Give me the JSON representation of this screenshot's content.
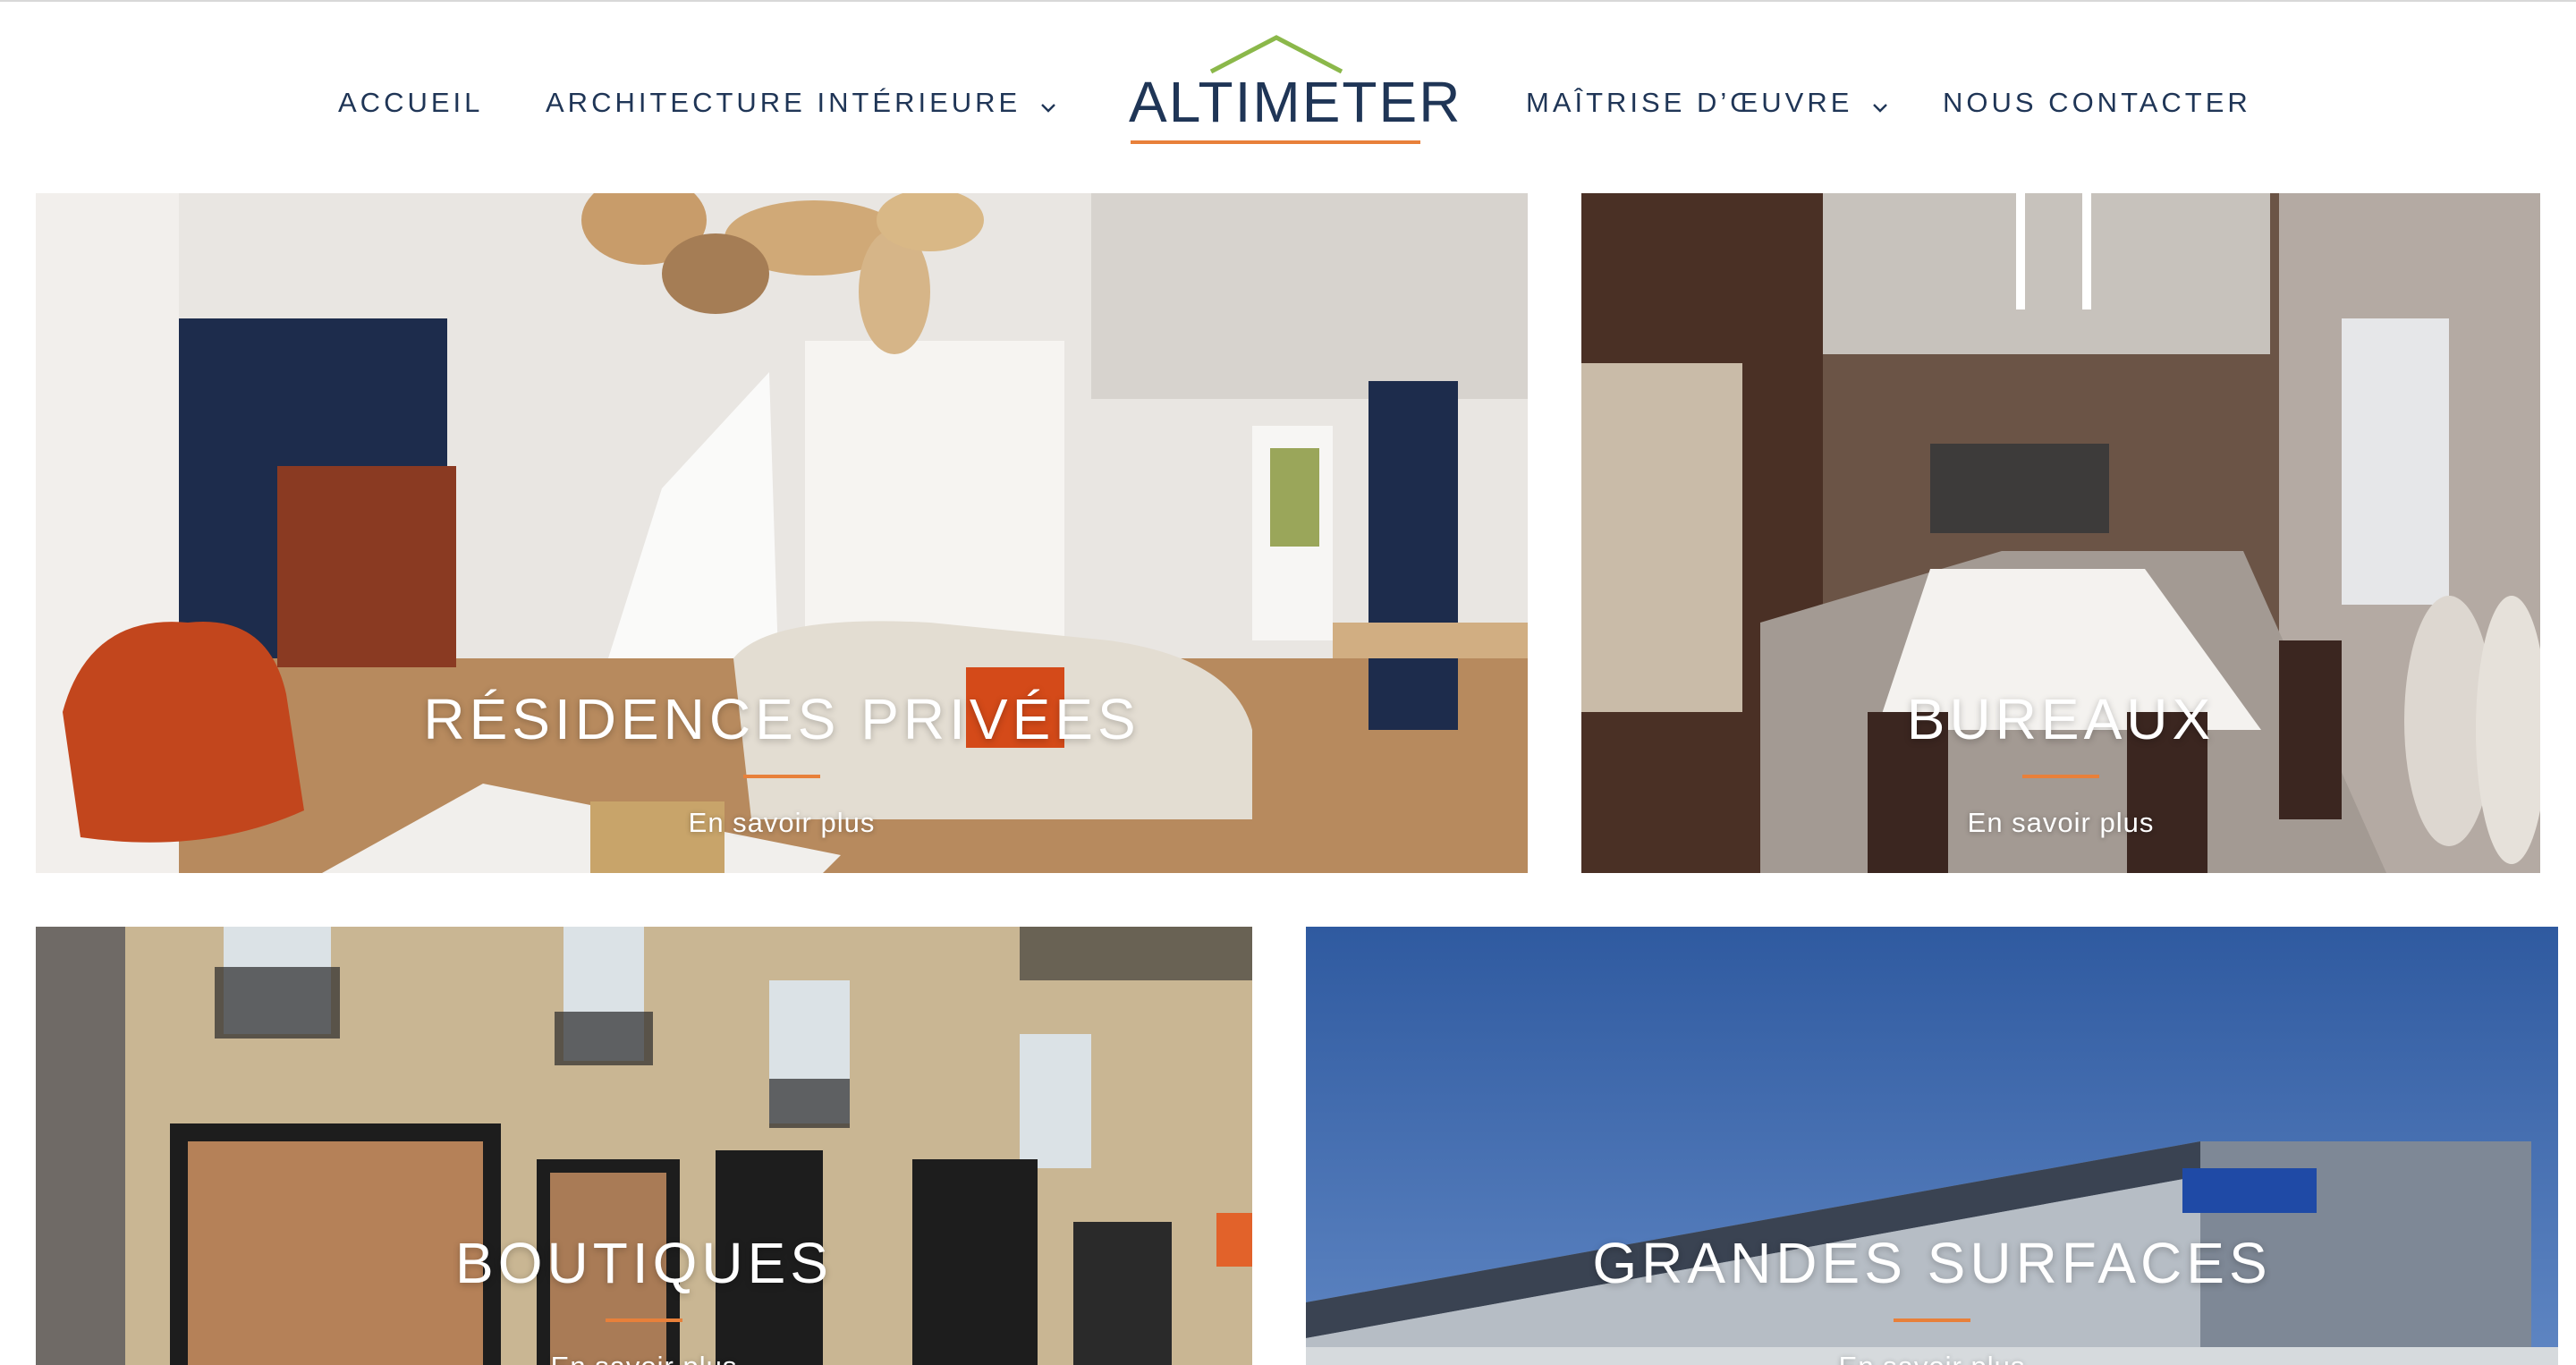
{
  "header": {
    "nav_left": [
      {
        "label": "ACCUEIL",
        "has_dropdown": false
      },
      {
        "label": "ARCHITECTURE INTÉRIEURE",
        "has_dropdown": true
      }
    ],
    "logo_text": "ALTIMETER",
    "nav_right": [
      {
        "label": "MAÎTRISE D’ŒUVRE",
        "has_dropdown": true
      },
      {
        "label": "NOUS CONTACTER",
        "has_dropdown": false
      }
    ]
  },
  "tiles": [
    {
      "title": "RÉSIDENCES PRIVÉES",
      "link": "En savoir plus"
    },
    {
      "title": "BUREAUX",
      "link": "En savoir plus"
    },
    {
      "title": "BOUTIQUES",
      "link": "En savoir plus"
    },
    {
      "title": "GRANDES SURFACES",
      "link": "En savoir plus"
    }
  ],
  "colors": {
    "navy": "#1f3556",
    "accent_orange": "#e8803a",
    "logo_roof_green": "#8bb84a"
  },
  "icons": {
    "dropdown": "chevron-down-icon",
    "logo_roof": "roof-icon"
  }
}
